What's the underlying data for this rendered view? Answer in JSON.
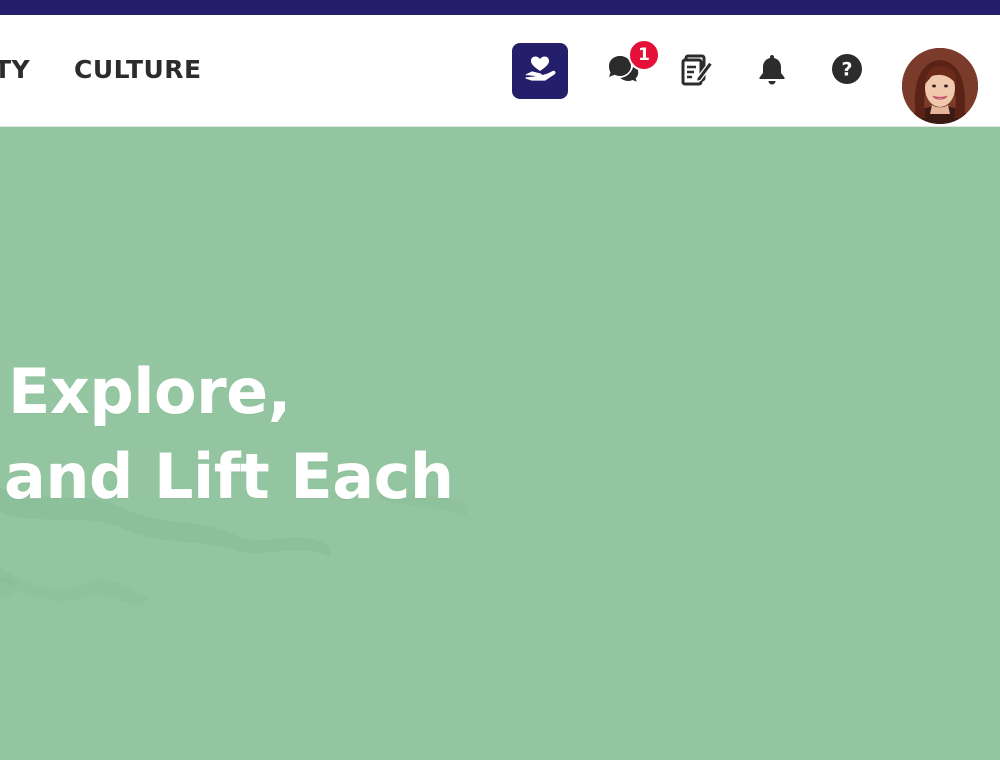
{
  "colors": {
    "top_strip": "#231f6b",
    "donate_button": "#231f6b",
    "hero_background": "#93c5a0",
    "badge": "#e4103a",
    "nav_text": "#2c2c2c"
  },
  "nav": {
    "partial_link": "TY",
    "culture_link": "CULTURE"
  },
  "header_icons": {
    "donate": "hand-heart-icon",
    "chat": "chat-bubbles-icon",
    "chat_badge_count": "1",
    "notes": "notes-edit-icon",
    "notifications": "bell-icon",
    "help": "help-circle-icon",
    "avatar": "user-avatar"
  },
  "hero": {
    "line1": "Explore,",
    "line2": "and Lift Each"
  }
}
